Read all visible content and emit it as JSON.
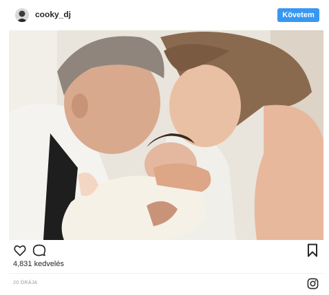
{
  "post": {
    "username": "cooky_dj",
    "follow_label": "Követem",
    "likes_text": "4,831 kedvelés",
    "timestamp": "20 ÓRÁJA"
  },
  "icons": {
    "like": "heart-icon",
    "comment": "speech-bubble-icon",
    "save": "bookmark-icon",
    "brand": "instagram-icon"
  },
  "colors": {
    "follow_button": "#3897f0",
    "text": "#262626",
    "muted": "#999999"
  }
}
